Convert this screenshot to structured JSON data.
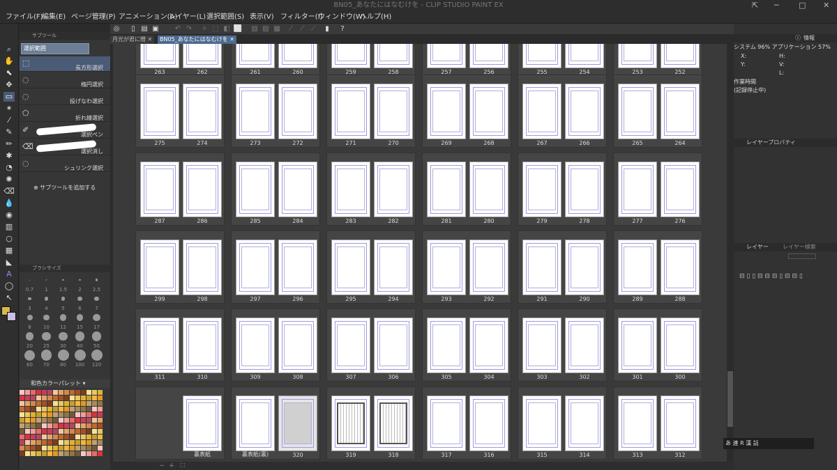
{
  "window": {
    "title": "BN05_あなたにはなむけを - CLIP STUDIO PAINT EX"
  },
  "menu": [
    "ファイル(F)",
    "編集(E)",
    "ページ管理(P)",
    "アニメーション(A)",
    "レイヤー(L)",
    "選択範囲(S)",
    "表示(V)",
    "フィルター(I)",
    "ウィンドウ(W)",
    "ヘルプ(H)"
  ],
  "tabs": [
    {
      "label": "月光が君に贈"
    },
    {
      "label": "BN05_あなたにはなむけを"
    }
  ],
  "subtool": {
    "panel_title": "サブツール",
    "group_tab": "選択範囲",
    "items": [
      {
        "label": "長方形選択",
        "icon": "rect-select-icon"
      },
      {
        "label": "楕円選択",
        "icon": "ellipse-select-icon"
      },
      {
        "label": "投げなわ選択",
        "icon": "lasso-icon"
      },
      {
        "label": "折れ線選択",
        "icon": "polyline-icon"
      },
      {
        "label": "選択ペン",
        "icon": "selection-pen-icon"
      },
      {
        "label": "選択消し",
        "icon": "selection-eraser-icon"
      },
      {
        "label": "シュリンク選択",
        "icon": "shrink-select-icon"
      }
    ],
    "add_label": "サブツールを追加する"
  },
  "brushsize": {
    "title": "ブラシサイズ",
    "sizes": [
      "0.7",
      "1",
      "1.5",
      "2",
      "2.5",
      "3",
      "4",
      "5",
      "6",
      "7",
      "8",
      "10",
      "12",
      "15",
      "17",
      "20",
      "25",
      "30",
      "40",
      "50",
      "60",
      "70",
      "80",
      "100",
      "120"
    ]
  },
  "colorset": {
    "title": "和色カラーパレット"
  },
  "pages": {
    "rows": [
      [
        [
          "263",
          "262"
        ],
        [
          "261",
          "260"
        ],
        [
          "259",
          "258"
        ],
        [
          "257",
          "256"
        ],
        [
          "255",
          "254"
        ],
        [
          "253",
          "252"
        ]
      ],
      [
        [
          "275",
          "274"
        ],
        [
          "273",
          "272"
        ],
        [
          "271",
          "270"
        ],
        [
          "269",
          "268"
        ],
        [
          "267",
          "266"
        ],
        [
          "265",
          "264"
        ]
      ],
      [
        [
          "287",
          "286"
        ],
        [
          "285",
          "284"
        ],
        [
          "283",
          "282"
        ],
        [
          "281",
          "280"
        ],
        [
          "279",
          "278"
        ],
        [
          "277",
          "276"
        ]
      ],
      [
        [
          "299",
          "298"
        ],
        [
          "297",
          "296"
        ],
        [
          "295",
          "294"
        ],
        [
          "293",
          "292"
        ],
        [
          "291",
          "290"
        ],
        [
          "289",
          "288"
        ]
      ],
      [
        [
          "311",
          "310"
        ],
        [
          "309",
          "308"
        ],
        [
          "307",
          "306"
        ],
        [
          "305",
          "304"
        ],
        [
          "303",
          "302"
        ],
        [
          "301",
          "300"
        ]
      ],
      [
        [
          "",
          "裏表紙"
        ],
        [
          "裏表紙(裏)",
          "320"
        ],
        [
          "319",
          "318"
        ],
        [
          "317",
          "316"
        ],
        [
          "315",
          "314"
        ],
        [
          "313",
          "312"
        ]
      ]
    ]
  },
  "info": {
    "tab": "情報",
    "system": "システム 96% アプリケーション 57%",
    "x": "X:",
    "y": "Y:",
    "h": "H:",
    "v": "V:",
    "l": "L:",
    "worktime_label": "作業時間",
    "worktime_value": "(記録停止中)"
  },
  "layer_property": {
    "title": "レイヤープロパティ"
  },
  "layer_panel": {
    "title": "レイヤー",
    "search_tab": "レイヤー検索"
  },
  "ime": {
    "text": "あ 連 R 漢 話"
  }
}
